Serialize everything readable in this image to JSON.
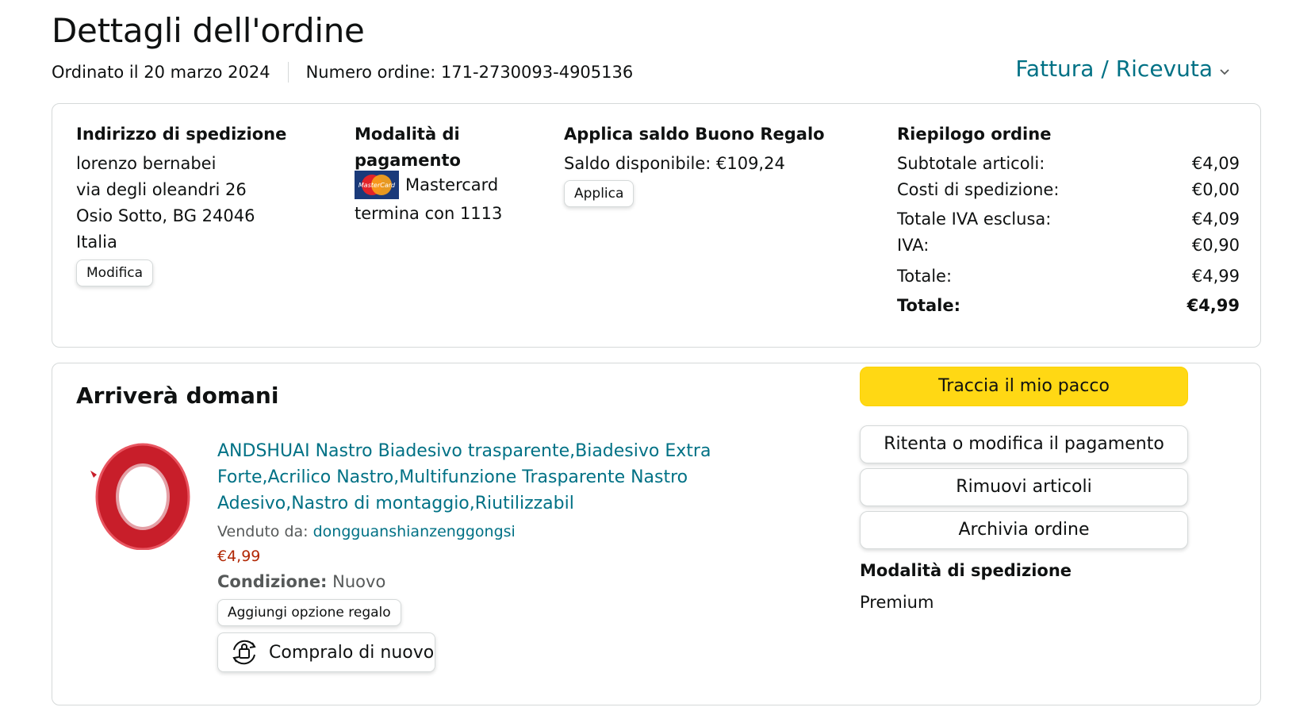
{
  "header": {
    "title": "Dettagli dell'ordine",
    "ordered_on": "Ordinato il 20 marzo 2024",
    "order_number": "Numero ordine: 171-2730093-4905136",
    "invoice_link": "Fattura / Ricevuta"
  },
  "shipping_address": {
    "title": "Indirizzo di spedizione",
    "lines": [
      "lorenzo bernabei",
      "via degli oleandri 26",
      "Osio Sotto, BG 24046",
      "Italia"
    ],
    "edit_button": "Modifica"
  },
  "payment": {
    "title_line1": "Modalità di",
    "title_line2": "pagamento",
    "card_brand": "Mastercard",
    "card_ending": "termina con 1113",
    "card_icon": "mastercard-icon",
    "card_icon_text": "MasterCard"
  },
  "gift_card": {
    "title": "Applica saldo Buono Regalo",
    "balance": "Saldo disponibile: €109,24",
    "apply_button": "Applica"
  },
  "summary": {
    "title": "Riepilogo ordine",
    "rows": [
      {
        "label": "Subtotale articoli:",
        "value": "€4,09"
      },
      {
        "label": "Costi di spedizione:",
        "value": "€0,00"
      },
      {
        "label": "Totale IVA esclusa:",
        "value": "€4,09"
      },
      {
        "label": "IVA:",
        "value": "€0,90"
      },
      {
        "label": "Totale:",
        "value": "€4,99"
      }
    ],
    "grand_total_label": "Totale:",
    "grand_total_value": "€4,99"
  },
  "shipment": {
    "status": "Arriverà domani",
    "product_title": "ANDSHUAI Nastro Biadesivo trasparente,Biadesivo Extra Forte,Acrilico Nastro,Multifunzione Trasparente Nastro Adesivo,Nastro di montaggio,Riutilizzabil",
    "sold_by_label": "Venduto da:",
    "seller": "dongguanshianzenggongsi",
    "price": "€4,99",
    "condition_label": "Condizione:",
    "condition_value": "Nuovo",
    "gift_button": "Aggiungi opzione regalo",
    "buy_again_button": "Compralo di nuovo"
  },
  "actions": {
    "track": "Traccia il mio pacco",
    "retry_payment": "Ritenta o modifica il pagamento",
    "remove_items": "Rimuovi articoli",
    "archive": "Archivia ordine",
    "shipping_method_title": "Modalità di spedizione",
    "shipping_method_value": "Premium"
  },
  "colors": {
    "link": "#007185",
    "price": "#b12704",
    "primary_button": "#ffd814",
    "border": "#d5d9d9"
  }
}
